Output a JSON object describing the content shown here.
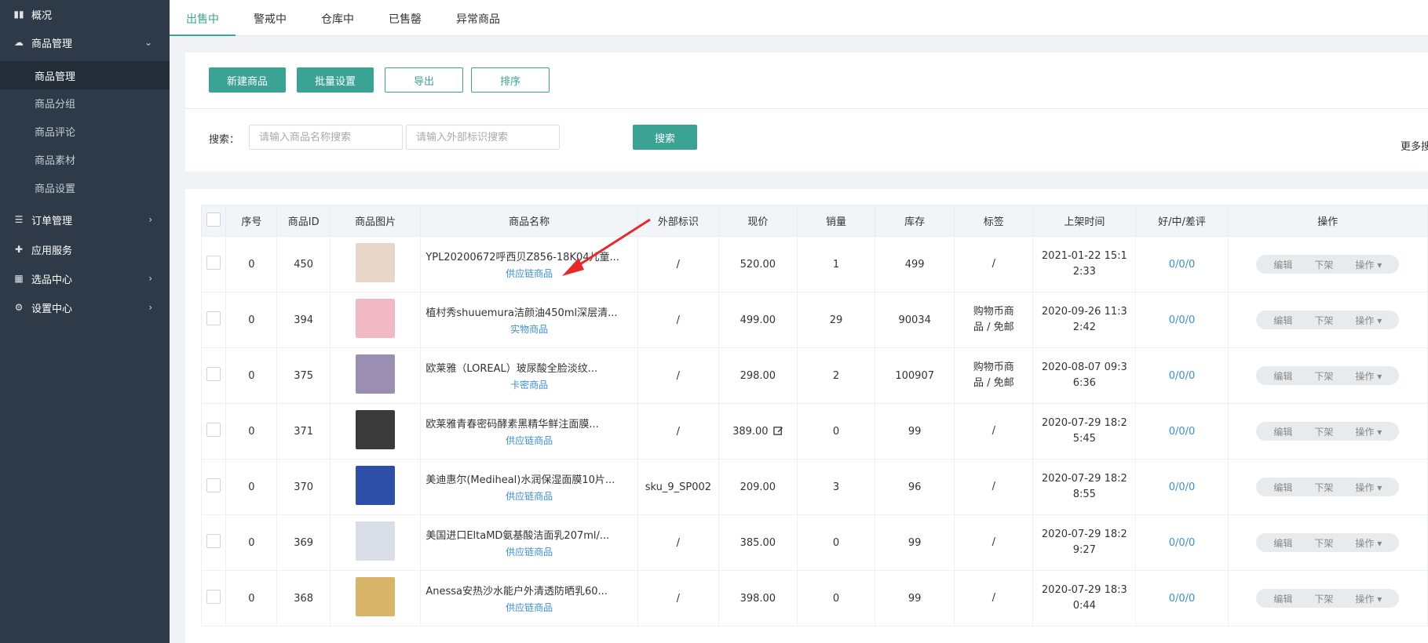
{
  "sidebar": {
    "items": [
      {
        "label": "概况",
        "icon": "book-icon"
      },
      {
        "label": "商品管理",
        "icon": "cloud-icon",
        "expanded": true,
        "children": [
          {
            "label": "商品管理",
            "active": true
          },
          {
            "label": "商品分组"
          },
          {
            "label": "商品评论"
          },
          {
            "label": "商品素材"
          },
          {
            "label": "商品设置"
          }
        ]
      },
      {
        "label": "订单管理",
        "icon": "list-icon"
      },
      {
        "label": "应用服务",
        "icon": "puzzle-icon"
      },
      {
        "label": "选品中心",
        "icon": "grid-icon"
      },
      {
        "label": "设置中心",
        "icon": "gear-icon"
      }
    ]
  },
  "tabs": [
    "出售中",
    "警戒中",
    "仓库中",
    "已售罄",
    "异常商品"
  ],
  "toolbar": {
    "new_label": "新建商品",
    "batch_label": "批量设置",
    "export_label": "导出",
    "sort_label": "排序"
  },
  "search": {
    "label": "搜索：",
    "name_placeholder": "请输入商品名称搜索",
    "ext_placeholder": "请输入外部标识搜索",
    "button_label": "搜索",
    "more_label": "更多搜"
  },
  "table": {
    "headers": [
      "序号",
      "商品ID",
      "商品图片",
      "商品名称",
      "外部标识",
      "现价",
      "销量",
      "库存",
      "标签",
      "上架时间",
      "好/中/差评",
      "操作"
    ],
    "rows": [
      {
        "seq": "0",
        "id": "450",
        "name": "YPL20200672呼西贝Z856-18K04儿童...",
        "type": "供应链商品",
        "ext": "/",
        "price": "520.00",
        "sales": "1",
        "stock": "499",
        "tag": "/",
        "time": "2021-01-22 15:12:33",
        "rating": "0/0/0",
        "thumb_color": "#e8d7c9"
      },
      {
        "seq": "0",
        "id": "394",
        "name": "植村秀shuuemura洁颜油450ml深层清...",
        "type": "实物商品",
        "ext": "/",
        "price": "499.00",
        "sales": "29",
        "stock": "90034",
        "tag": "购物币商品 / 免邮",
        "time": "2020-09-26 11:32:42",
        "rating": "0/0/0",
        "thumb_color": "#f1b9c6"
      },
      {
        "seq": "0",
        "id": "375",
        "name": "欧莱雅（LOREAL）玻尿酸全脸淡纹...",
        "type": "卡密商品",
        "ext": "/",
        "price": "298.00",
        "sales": "2",
        "stock": "100907",
        "tag": "购物币商品 / 免邮",
        "time": "2020-08-07 09:36:36",
        "rating": "0/0/0",
        "thumb_color": "#9a8fb3"
      },
      {
        "seq": "0",
        "id": "371",
        "name": "欧莱雅青春密码酵素黑精华鲜注面膜...",
        "type": "供应链商品",
        "ext": "/",
        "price": "389.00",
        "sales": "0",
        "stock": "99",
        "tag": "/",
        "time": "2020-07-29 18:25:45",
        "rating": "0/0/0",
        "thumb_color": "#3a3a3a"
      },
      {
        "seq": "0",
        "id": "370",
        "name": "美迪惠尔(Mediheal)水润保湿面膜10片...",
        "type": "供应链商品",
        "ext": "sku_9_SP002",
        "price": "209.00",
        "sales": "3",
        "stock": "96",
        "tag": "/",
        "time": "2020-07-29 18:28:55",
        "rating": "0/0/0",
        "thumb_color": "#2d4fa8"
      },
      {
        "seq": "0",
        "id": "369",
        "name": "美国进口EltaMD氨基酸洁面乳207ml/...",
        "type": "供应链商品",
        "ext": "/",
        "price": "385.00",
        "sales": "0",
        "stock": "99",
        "tag": "/",
        "time": "2020-07-29 18:29:27",
        "rating": "0/0/0",
        "thumb_color": "#d9dde8"
      },
      {
        "seq": "0",
        "id": "368",
        "name": "Anessa安热沙水能户外清透防晒乳60...",
        "type": "供应链商品",
        "ext": "/",
        "price": "398.00",
        "sales": "0",
        "stock": "99",
        "tag": "/",
        "time": "2020-07-29 18:30:44",
        "rating": "0/0/0",
        "thumb_color": "#d9b56a"
      }
    ],
    "ops": {
      "edit": "编辑",
      "off": "下架",
      "more": "操作 ▾"
    }
  }
}
